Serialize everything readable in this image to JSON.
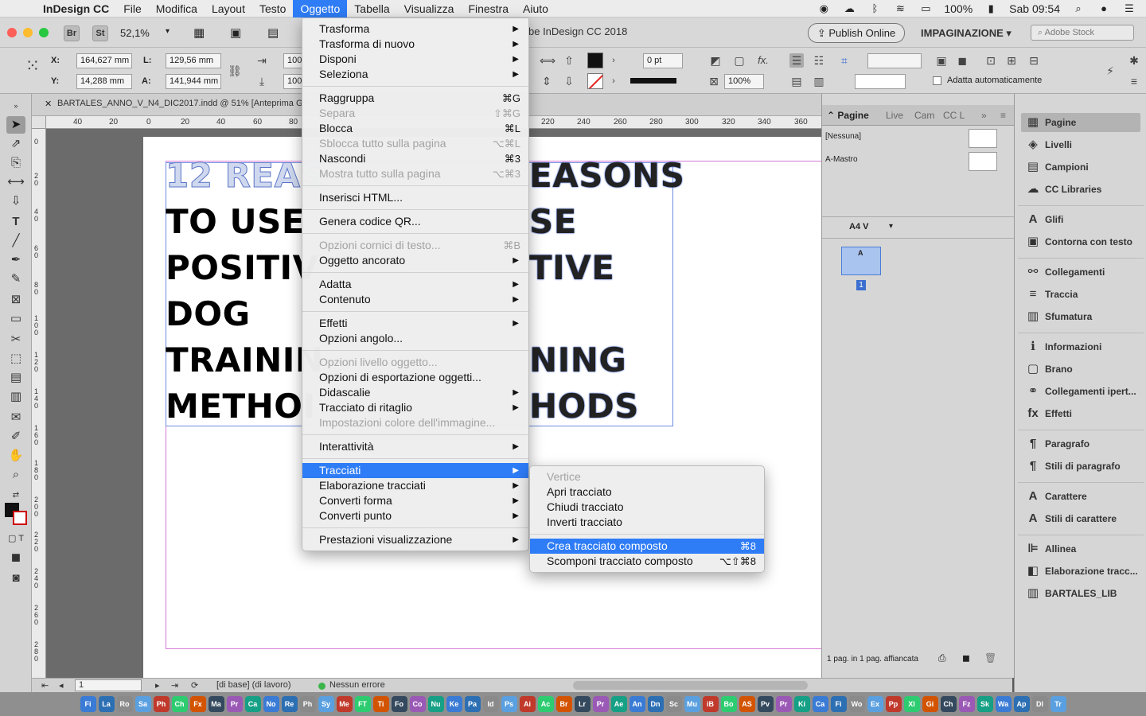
{
  "menubar": {
    "app_name": "InDesign CC",
    "items": [
      "File",
      "Modifica",
      "Layout",
      "Testo",
      "Oggetto",
      "Tabella",
      "Visualizza",
      "Finestra",
      "Aiuto"
    ],
    "active_item": "Oggetto",
    "battery": "100%",
    "clock": "Sab 09:54"
  },
  "titlebar": {
    "zoom": "52,1%",
    "doc_title": "be InDesign CC 2018",
    "publish_label": "Publish Online",
    "workspace": "IMPAGINAZIONE",
    "stock_placeholder": "Adobe Stock",
    "br": "Br",
    "st": "St"
  },
  "controlbar": {
    "x_label": "X:",
    "x_value": "164,627 mm",
    "y_label": "Y:",
    "y_value": "14,288 mm",
    "w_label": "L:",
    "w_value": "129,56 mm",
    "h_label": "A:",
    "h_value": "141,944 mm",
    "scale_x": "100",
    "scale_y": "100",
    "stroke_weight": "0 pt",
    "opacity": "100%",
    "autofit_label": "Adatta automaticamente"
  },
  "tab": {
    "label": "BARTALES_ANNO_V_N4_DIC2017.indd @ 51% [Anteprima GP"
  },
  "ruler_h": [
    "40",
    "20",
    "0",
    "20",
    "40",
    "60",
    "80",
    "220",
    "240",
    "260",
    "280",
    "300",
    "320",
    "340",
    "360"
  ],
  "ruler_v": [
    "0",
    "20",
    "40",
    "60",
    "80",
    "100",
    "120",
    "140",
    "160",
    "180",
    "200",
    "220",
    "240",
    "260",
    "280"
  ],
  "canvas": {
    "left_lines": [
      "12 REAS",
      "TO USE",
      "POSITIV",
      "DOG",
      "TRAININ",
      "METHOI"
    ],
    "right_lines": [
      "EASONS",
      "SE",
      "TIVE",
      "",
      "NING",
      "HODS"
    ]
  },
  "object_menu": {
    "items": [
      {
        "label": "Trasforma",
        "sub": true
      },
      {
        "label": "Trasforma di nuovo",
        "sub": true
      },
      {
        "label": "Disponi",
        "sub": true
      },
      {
        "label": "Seleziona",
        "sub": true
      },
      {
        "sep": true
      },
      {
        "label": "Raggruppa",
        "sc": "⌘G"
      },
      {
        "label": "Separa",
        "sc": "⇧⌘G",
        "dis": true
      },
      {
        "label": "Blocca",
        "sc": "⌘L"
      },
      {
        "label": "Sblocca tutto sulla pagina",
        "sc": "⌥⌘L",
        "dis": true
      },
      {
        "label": "Nascondi",
        "sc": "⌘3"
      },
      {
        "label": "Mostra tutto sulla pagina",
        "sc": "⌥⌘3",
        "dis": true
      },
      {
        "sep": true
      },
      {
        "label": "Inserisci HTML..."
      },
      {
        "sep": true
      },
      {
        "label": "Genera codice QR..."
      },
      {
        "sep": true
      },
      {
        "label": "Opzioni cornici di testo...",
        "sc": "⌘B",
        "dis": true
      },
      {
        "label": "Oggetto ancorato",
        "sub": true
      },
      {
        "sep": true
      },
      {
        "label": "Adatta",
        "sub": true
      },
      {
        "label": "Contenuto",
        "sub": true
      },
      {
        "sep": true
      },
      {
        "label": "Effetti",
        "sub": true
      },
      {
        "label": "Opzioni angolo..."
      },
      {
        "sep": true
      },
      {
        "label": "Opzioni livello oggetto...",
        "dis": true
      },
      {
        "label": "Opzioni di esportazione oggetti..."
      },
      {
        "label": "Didascalie",
        "sub": true
      },
      {
        "label": "Tracciato di ritaglio",
        "sub": true
      },
      {
        "label": "Impostazioni colore dell'immagine...",
        "dis": true
      },
      {
        "sep": true
      },
      {
        "label": "Interattività",
        "sub": true
      },
      {
        "sep": true
      },
      {
        "label": "Tracciati",
        "sub": true,
        "hl": true
      },
      {
        "label": "Elaborazione tracciati",
        "sub": true
      },
      {
        "label": "Converti forma",
        "sub": true
      },
      {
        "label": "Converti punto",
        "sub": true
      },
      {
        "sep": true
      },
      {
        "label": "Prestazioni visualizzazione",
        "sub": true
      }
    ]
  },
  "paths_submenu": {
    "items": [
      {
        "label": "Vertice",
        "dis": true
      },
      {
        "label": "Apri tracciato"
      },
      {
        "label": "Chiudi tracciato"
      },
      {
        "label": "Inverti tracciato"
      },
      {
        "sep": true
      },
      {
        "label": "Crea tracciato composto",
        "sc": "⌘8",
        "hl": true
      },
      {
        "label": "Scomponi tracciato composto",
        "sc": "⌥⇧⌘8"
      }
    ]
  },
  "pages_panel": {
    "tabs": [
      "Pagine",
      "Live",
      "Cam",
      "CC L"
    ],
    "none_master": "[Nessuna]",
    "a_master": "A-Mastro",
    "page_size": "A4 V",
    "page_number": "1",
    "footer": "1 pag. in 1 pag. affiancata"
  },
  "panel_list": {
    "items": [
      {
        "label": "Pagine",
        "icon": "▦",
        "sel": true
      },
      {
        "label": "Livelli",
        "icon": "◈"
      },
      {
        "label": "Campioni",
        "icon": "▤"
      },
      {
        "label": "CC Libraries",
        "icon": "☁"
      },
      {
        "sep": true
      },
      {
        "label": "Glifi",
        "icon": "A"
      },
      {
        "label": "Contorna con testo",
        "icon": "▣"
      },
      {
        "sep": true
      },
      {
        "label": "Collegamenti",
        "icon": "⚯"
      },
      {
        "label": "Traccia",
        "icon": "≡"
      },
      {
        "label": "Sfumatura",
        "icon": "▥"
      },
      {
        "sep": true
      },
      {
        "label": "Informazioni",
        "icon": "ℹ"
      },
      {
        "label": "Brano",
        "icon": "▢"
      },
      {
        "label": "Collegamenti ipert...",
        "icon": "⚭"
      },
      {
        "label": "Effetti",
        "icon": "fx"
      },
      {
        "sep": true
      },
      {
        "label": "Paragrafo",
        "icon": "¶"
      },
      {
        "label": "Stili di paragrafo",
        "icon": "¶"
      },
      {
        "sep": true
      },
      {
        "label": "Carattere",
        "icon": "A"
      },
      {
        "label": "Stili di carattere",
        "icon": "A"
      },
      {
        "sep": true
      },
      {
        "label": "Allinea",
        "icon": "⊫"
      },
      {
        "label": "Elaborazione tracc...",
        "icon": "◧"
      },
      {
        "label": "BARTALES_LIB",
        "icon": "▥"
      }
    ]
  },
  "statusbar": {
    "page": "1",
    "base": "[di base] (di lavoro)",
    "errors": "Nessun errore"
  },
  "dock": [
    "Fi",
    "La",
    "Ro",
    "Sa",
    "Ph",
    "Ch",
    "Fx",
    "Ma",
    "Pr",
    "Ca",
    "No",
    "Re",
    "Ph",
    "Sy",
    "Me",
    "FT",
    "Ti",
    "Fo",
    "Co",
    "Nu",
    "Ke",
    "Pa",
    "Id",
    "Ps",
    "Ai",
    "Ac",
    "Br",
    "Lr",
    "Pr",
    "Ae",
    "An",
    "Dn",
    "Sc",
    "Mu",
    "iB",
    "Bo",
    "AS",
    "Pv",
    "Pr",
    "Ki",
    "Ca",
    "Fi",
    "Wo",
    "Ex",
    "Pp",
    "Xl",
    "Gi",
    "Ch",
    "Fz",
    "Sk",
    "Wa",
    "Ap",
    "Dl",
    "Tr"
  ]
}
